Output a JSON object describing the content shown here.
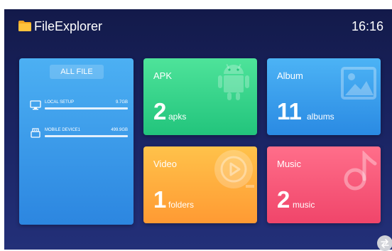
{
  "header": {
    "app_title": "FileExplorer",
    "clock": "16:16",
    "folder_icon": "folder-icon"
  },
  "all_file": {
    "button_label": "ALL FILE",
    "devices": [
      {
        "name": "LOCAL SETUP",
        "size": "9.7GB",
        "icon": "monitor-icon"
      },
      {
        "name": "MOBILE DEVICE1",
        "size": "499.9GB",
        "icon": "usb-drive-icon"
      }
    ]
  },
  "tiles": {
    "apk": {
      "label": "APK",
      "count": "2",
      "unit": "apks",
      "icon": "android-icon",
      "color": "#22c47c"
    },
    "album": {
      "label": "Album",
      "count": "11",
      "unit": "albums",
      "icon": "image-icon",
      "color": "#2a8ae3"
    },
    "video": {
      "label": "Video",
      "count": "1",
      "unit": "folders",
      "icon": "video-play-icon",
      "color": "#ff9a33"
    },
    "music": {
      "label": "Music",
      "count": "2",
      "unit": "music",
      "icon": "music-note-icon",
      "color": "#f0456a"
    }
  },
  "colors": {
    "background_top": "#131a4a",
    "background_bottom": "#233079",
    "all_file_card": "#2c86e0"
  }
}
